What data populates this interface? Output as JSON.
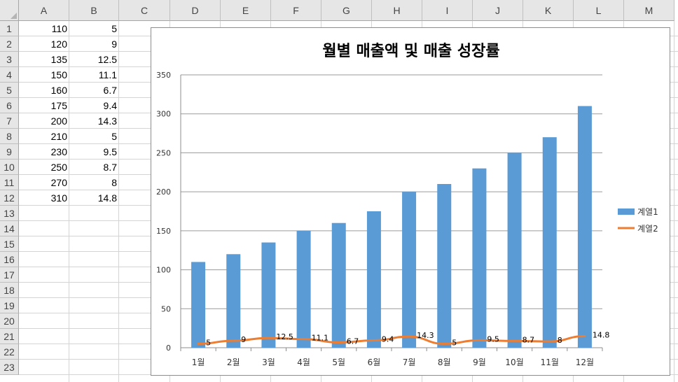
{
  "sheet": {
    "columns": [
      "A",
      "B",
      "C",
      "D",
      "E",
      "F",
      "G",
      "H",
      "I",
      "J",
      "K",
      "L",
      "M"
    ],
    "rows": [
      "1",
      "2",
      "3",
      "4",
      "5",
      "6",
      "7",
      "8",
      "9",
      "10",
      "11",
      "12",
      "13",
      "14",
      "15",
      "16",
      "17",
      "18",
      "19",
      "20",
      "21",
      "22",
      "23"
    ],
    "cells": {
      "A": [
        "110",
        "120",
        "135",
        "150",
        "160",
        "175",
        "200",
        "210",
        "230",
        "250",
        "270",
        "310"
      ],
      "B": [
        "5",
        "9",
        "12.5",
        "11.1",
        "6.7",
        "9.4",
        "14.3",
        "5",
        "9.5",
        "8.7",
        "8",
        "14.8"
      ]
    }
  },
  "chart_data": {
    "type": "bar",
    "title": "월별 매출액 및 매출 성장률",
    "categories": [
      "1월",
      "2월",
      "3월",
      "4월",
      "5월",
      "6월",
      "7월",
      "8월",
      "9월",
      "10월",
      "11월",
      "12월"
    ],
    "series": [
      {
        "name": "계열1",
        "type": "bar",
        "color": "#5b9bd5",
        "values": [
          110,
          120,
          135,
          150,
          160,
          175,
          200,
          210,
          230,
          250,
          270,
          310
        ]
      },
      {
        "name": "계열2",
        "type": "line",
        "color": "#ed7d31",
        "values": [
          5,
          9,
          12.5,
          11.1,
          6.7,
          9.4,
          14.3,
          5,
          9.5,
          8.7,
          8,
          14.8
        ],
        "data_labels": [
          "5",
          "9",
          "12.5",
          "11.1",
          "6.7",
          "9.4",
          "14.3",
          "5",
          "9.5",
          "8.7",
          "8",
          "14.8"
        ]
      }
    ],
    "ylim": [
      0,
      350
    ],
    "yticks": [
      "0",
      "50",
      "100",
      "150",
      "200",
      "250",
      "300",
      "350"
    ],
    "grid": true,
    "legend": "right"
  }
}
